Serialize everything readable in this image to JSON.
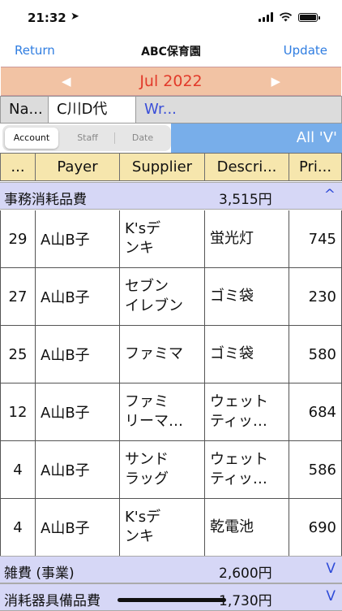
{
  "status": {
    "time": "21:32",
    "location_arrow": "➤"
  },
  "nav": {
    "left": "Return",
    "title": "ABC保育園",
    "right": "Update"
  },
  "month": {
    "prev": "◀",
    "label": "Jul 2022",
    "next": "▶"
  },
  "filter": {
    "name_label": "Na...",
    "name_value": "C川D代",
    "extra": "Wr..."
  },
  "segment": {
    "options": [
      "Account",
      "Staff",
      "Date"
    ],
    "selected": "Account"
  },
  "blue_label": "All 'V'",
  "headers": [
    "...",
    "Payer",
    "Supplier",
    "Descri...",
    "Pri..."
  ],
  "groups": [
    {
      "name": "事務消耗品費",
      "amount": "3,515円",
      "toggle": "^"
    },
    {
      "name": "雑費 (事業)",
      "amount": "2,600円",
      "toggle": "V"
    },
    {
      "name": "消耗器具備品費",
      "amount": "1,730円",
      "toggle": "V"
    }
  ],
  "rows": [
    {
      "num": "29",
      "payer": "A山B子",
      "supplier": [
        "K'sデ",
        "ンキ"
      ],
      "desc": [
        "蛍光灯"
      ],
      "price": "745"
    },
    {
      "num": "27",
      "payer": "A山B子",
      "supplier": [
        "セブン",
        "イレブン"
      ],
      "desc": [
        "ゴミ袋"
      ],
      "price": "230"
    },
    {
      "num": "25",
      "payer": "A山B子",
      "supplier": [
        "ファミマ"
      ],
      "desc": [
        "ゴミ袋"
      ],
      "price": "580"
    },
    {
      "num": "12",
      "payer": "A山B子",
      "supplier": [
        "ファミ",
        "リーマ…"
      ],
      "desc": [
        "ウェット",
        "ティッ…"
      ],
      "price": "684"
    },
    {
      "num": "4",
      "payer": "A山B子",
      "supplier": [
        "サンド",
        "ラッグ"
      ],
      "desc": [
        "ウェット",
        "ティッ…"
      ],
      "price": "586"
    },
    {
      "num": "4",
      "payer": "A山B子",
      "supplier": [
        "K'sデ",
        "ンキ"
      ],
      "desc": [
        "乾電池"
      ],
      "price": "690"
    }
  ]
}
